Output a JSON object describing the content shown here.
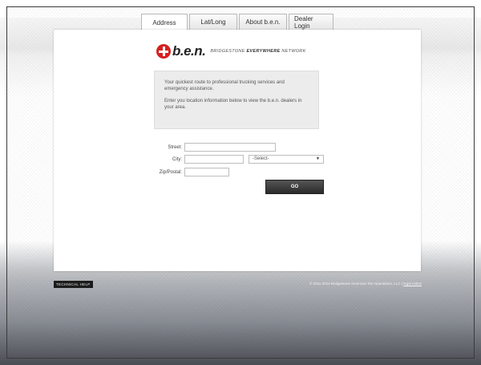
{
  "tabs": [
    {
      "label": "Address",
      "active": true
    },
    {
      "label": "Lat/Long",
      "active": false
    },
    {
      "label": "About b.e.n.",
      "active": false
    },
    {
      "label": "Dealer Login",
      "active": false
    }
  ],
  "logo": {
    "brand": "b.e.n.",
    "tagline_prefix": "BRIDGESTONE",
    "tagline_bold": "EVERYWHERE",
    "tagline_suffix": "NETWORK",
    "brand_color": "#d6201f"
  },
  "info": {
    "line1": "Your quickest route to professional trucking services and emergency assistance.",
    "line2": "Enter you location information below to view the b.e.n. dealers in your area."
  },
  "form": {
    "street_label": "Street:",
    "street_value": "",
    "city_label": "City:",
    "city_value": "",
    "state_select": "-Select-",
    "zip_label": "Zip/Postal:",
    "zip_value": "",
    "go_label": "GO"
  },
  "footer": {
    "tech_help": "TECHNICAL HELP",
    "copyright": "© 2011-2014 Bridgestone Americas Tire Operations, LLC | ",
    "legal_notice": "legal notice"
  }
}
